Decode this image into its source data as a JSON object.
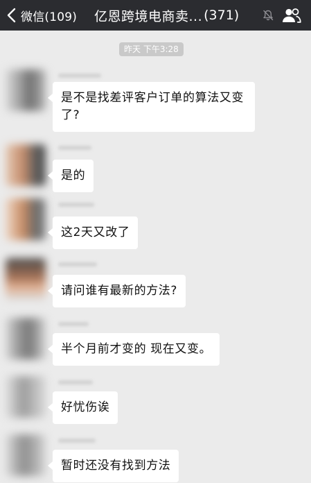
{
  "header": {
    "back_label": "微信(109)",
    "title": "亿恩跨境电商卖...",
    "member_count": "(371)",
    "back_icon": "chevron-left-icon",
    "mute_icon": "muted-bell-icon",
    "members_icon": "people-icon"
  },
  "timestamp": "昨天 下午3:28",
  "messages": [
    {
      "text": "是不是找差评客户订单的算法又变了?"
    },
    {
      "text": "是的"
    },
    {
      "text": "这2天又改了"
    },
    {
      "text": "请问谁有最新的方法?"
    },
    {
      "text": "半个月前才变的  现在又变。"
    },
    {
      "text": "好忧伤诶"
    },
    {
      "text": "暂时还没有找到方法"
    }
  ],
  "colors": {
    "header_bg": "#2b2c30",
    "chat_bg": "#ebebeb",
    "bubble_bg": "#ffffff",
    "timestamp_bg": "#c9c9c9"
  }
}
